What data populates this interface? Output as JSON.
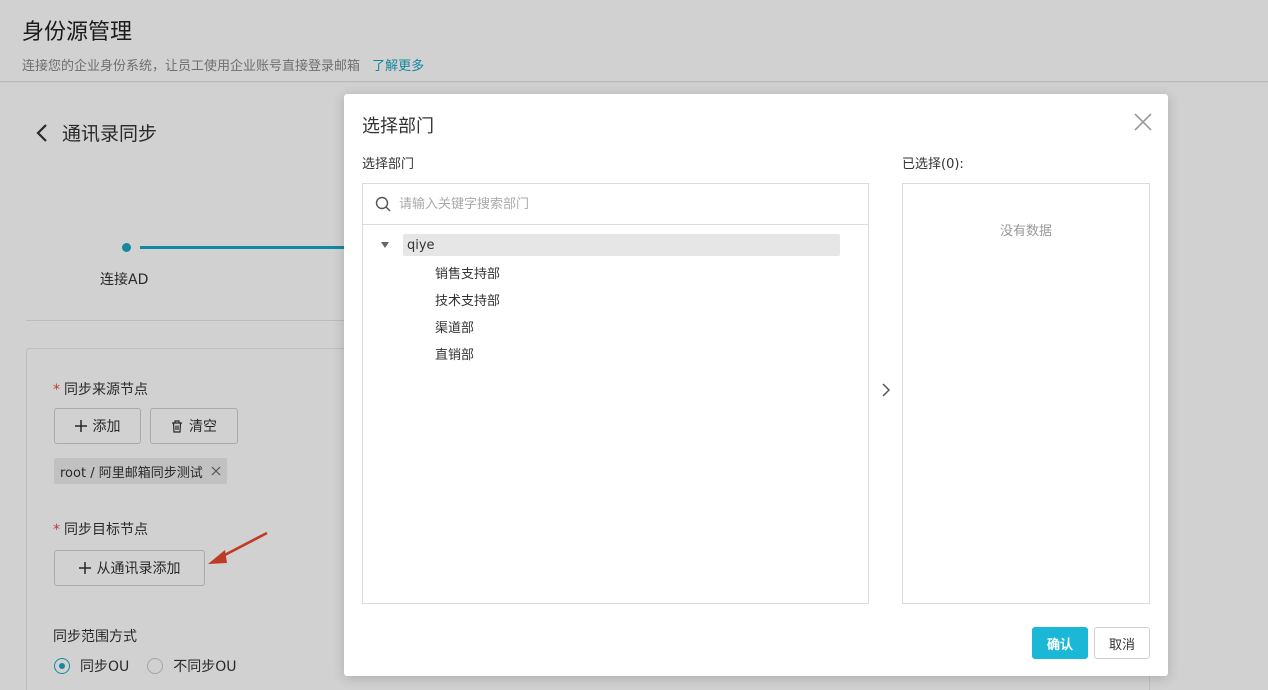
{
  "header": {
    "title": "身份源管理",
    "description": "连接您的企业身份系统，让员工使用企业账号直接登录邮箱",
    "learn_more": "了解更多"
  },
  "page": {
    "back_title": "通讯录同步",
    "step_label": "连接AD",
    "source_node_label": "同步来源节点",
    "add_button": "添加",
    "clear_button": "清空",
    "source_tag": "root / 阿里邮箱同步测试",
    "target_node_label": "同步目标节点",
    "add_from_directory_button": "从通讯录添加",
    "scope_label": "同步范围方式",
    "scope_options": [
      "同步OU",
      "不同步OU"
    ],
    "scope_selected": "同步OU",
    "required_mark": "*"
  },
  "modal": {
    "title": "选择部门",
    "left_label": "选择部门",
    "search_placeholder": "请输入关键字搜索部门",
    "tree": {
      "root": "qiye",
      "children": [
        "销售支持部",
        "技术支持部",
        "渠道部",
        "直销部"
      ]
    },
    "right_label": "已选择(0):",
    "empty_text": "没有数据",
    "confirm": "确认",
    "cancel": "取消"
  },
  "colors": {
    "accent": "#1aa6c4",
    "confirm_bg": "#1ab8d6",
    "required": "#e64b3c"
  }
}
